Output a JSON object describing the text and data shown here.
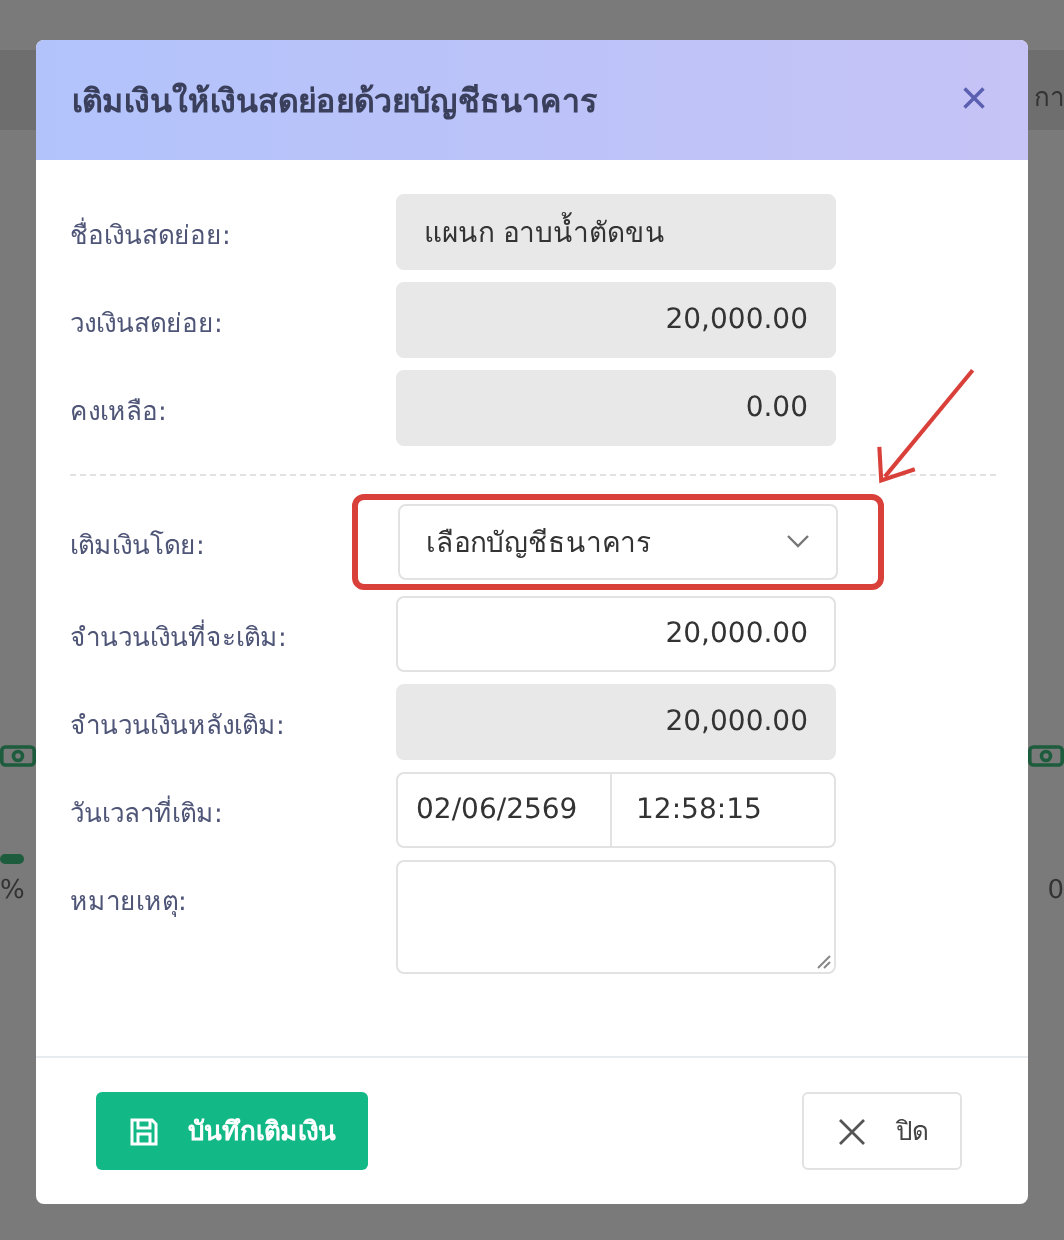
{
  "background": {
    "top_right_text": "กา",
    "left_text": "%",
    "right_text": "0"
  },
  "dialog": {
    "title": "เติมเงินให้เงินสดย่อยด้วยบัญชีธนาคาร",
    "close": "×",
    "fields": [
      {
        "kind": "readonly",
        "label": "ชื่อเงินสดย่อย:",
        "value": "แผนก อาบน้ำตัดขน",
        "numeric": false
      },
      {
        "kind": "readonly",
        "label": "วงเงินสดย่อย:",
        "value": "20,000.00",
        "numeric": true
      },
      {
        "kind": "readonly",
        "label": "คงเหลือ:",
        "value": "0.00",
        "numeric": true
      },
      {
        "kind": "divider"
      },
      {
        "kind": "select",
        "label": "เติมเงินโดย:",
        "value": "เลือกบัญชีธนาคาร",
        "highlighted": true
      },
      {
        "kind": "input",
        "label": "จำนวนเงินที่จะเติม:",
        "value": "20,000.00",
        "numeric": true
      },
      {
        "kind": "readonly",
        "label": "จำนวนเงินหลังเติม:",
        "value": "20,000.00",
        "numeric": true
      },
      {
        "kind": "datetime",
        "label": "วันเวลาที่เติม:",
        "date": "02/06/2569",
        "time": "12:58:15"
      },
      {
        "kind": "textarea",
        "label": "หมายเหตุ:"
      }
    ],
    "buttons": [
      {
        "kind": "primary",
        "label": "บันทึกเติมเงิน"
      },
      {
        "kind": "secondary",
        "label": "ปิด"
      }
    ]
  }
}
